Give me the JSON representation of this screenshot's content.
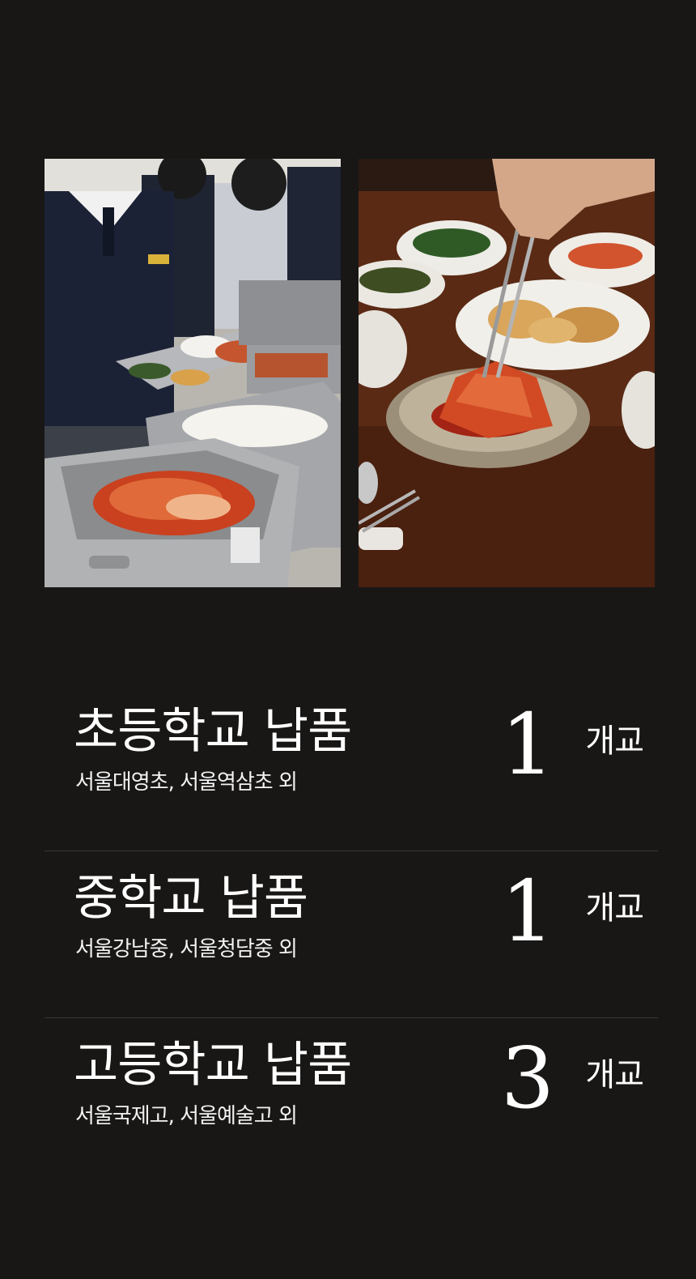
{
  "photos": {
    "left_icon": "school-cafeteria-kimchi-photo",
    "right_icon": "kimchi-banchan-table-photo"
  },
  "stats": [
    {
      "title": "초등학교 납품",
      "subtitle": "서울대영초, 서울역삼초 외",
      "count": "1",
      "unit": "개교"
    },
    {
      "title": "중학교 납품",
      "subtitle": "서울강남중, 서울청담중 외",
      "count": "1",
      "unit": "개교"
    },
    {
      "title": "고등학교 납품",
      "subtitle": "서울국제고, 서울예술고 외",
      "count": "3",
      "unit": "개교"
    }
  ]
}
